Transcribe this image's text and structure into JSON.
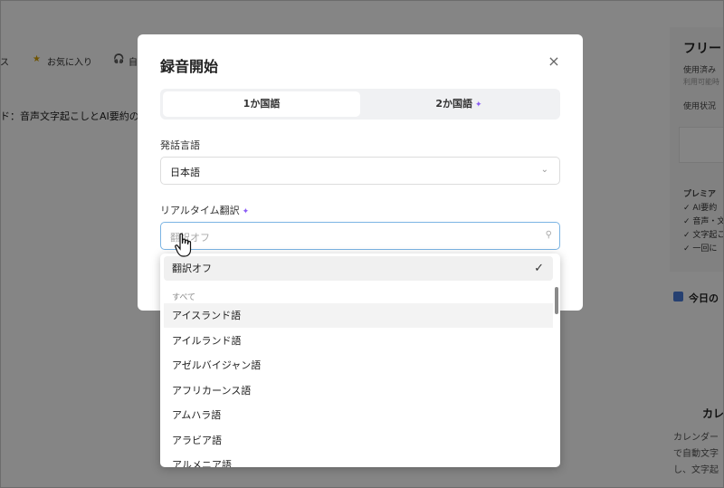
{
  "background": {
    "nav_items": [
      "ス",
      "お気に入り",
      "自"
    ],
    "heading": "ド：音声文字起こしとAI要約の使",
    "side": {
      "title": "フリー",
      "usage_label": "使用済み",
      "usage_sub": "利用可能時",
      "status_label": "使用状況",
      "premium_label": "プレミア",
      "features": [
        "AI要約",
        "音声・文",
        "文字起こ",
        "一回に"
      ],
      "today_label": "今日の",
      "calendar_title": "カレ",
      "calendar_lines": [
        "カレンダー",
        "で自動文字",
        "し、文字起"
      ]
    }
  },
  "modal": {
    "title": "録音開始",
    "close_label": "×",
    "tabs": [
      {
        "label": "1か国語",
        "active": true
      },
      {
        "label": "2か国語",
        "active": false
      }
    ],
    "speech_label": "発話言語",
    "speech_value": "日本語",
    "translation_label": "リアルタイム翻訳",
    "search_placeholder": "翻訳オフ"
  },
  "dropdown": {
    "selected_option": "翻訳オフ",
    "group_label": "すべて",
    "options": [
      "アイスランド語",
      "アイルランド語",
      "アゼルバイジャン語",
      "アフリカーンス語",
      "アムハラ語",
      "アラビア語",
      "アルメニア語"
    ]
  },
  "icons": {
    "sparkle": "✦",
    "checkmark": "✓",
    "chevron": "⌄",
    "search": "⚲"
  },
  "colors": {
    "accent_border": "#7bb4e3",
    "sparkle": "#8b5cf6"
  }
}
